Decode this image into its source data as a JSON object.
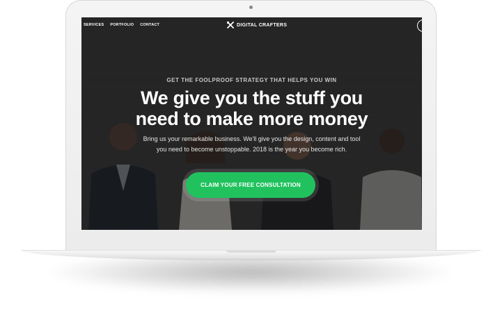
{
  "nav": {
    "links": [
      "SERVICES",
      "PORTFOLIO",
      "CONTACT"
    ],
    "brand": "DIGITAL CRAFTERS",
    "brand_icon": "crossed-tools-icon",
    "menu_icon": "circle-menu-icon"
  },
  "hero": {
    "eyebrow": "GET THE FOOLPROOF STRATEGY THAT HELPS YOU WIN",
    "headline_line1": "We give you the stuff you",
    "headline_line2": "need to make more money",
    "sub_line1": "Bring us your remarkable business. We'll give you the design, content and tool",
    "sub_line2": "you need to become unstoppable. 2018 is the year you become rich.",
    "cta_label": "CLAIM YOUR FREE CONSULTATION"
  },
  "colors": {
    "accent": "#21c25e",
    "overlay": "#141414",
    "laptop_frame": "#f0f0f0"
  }
}
